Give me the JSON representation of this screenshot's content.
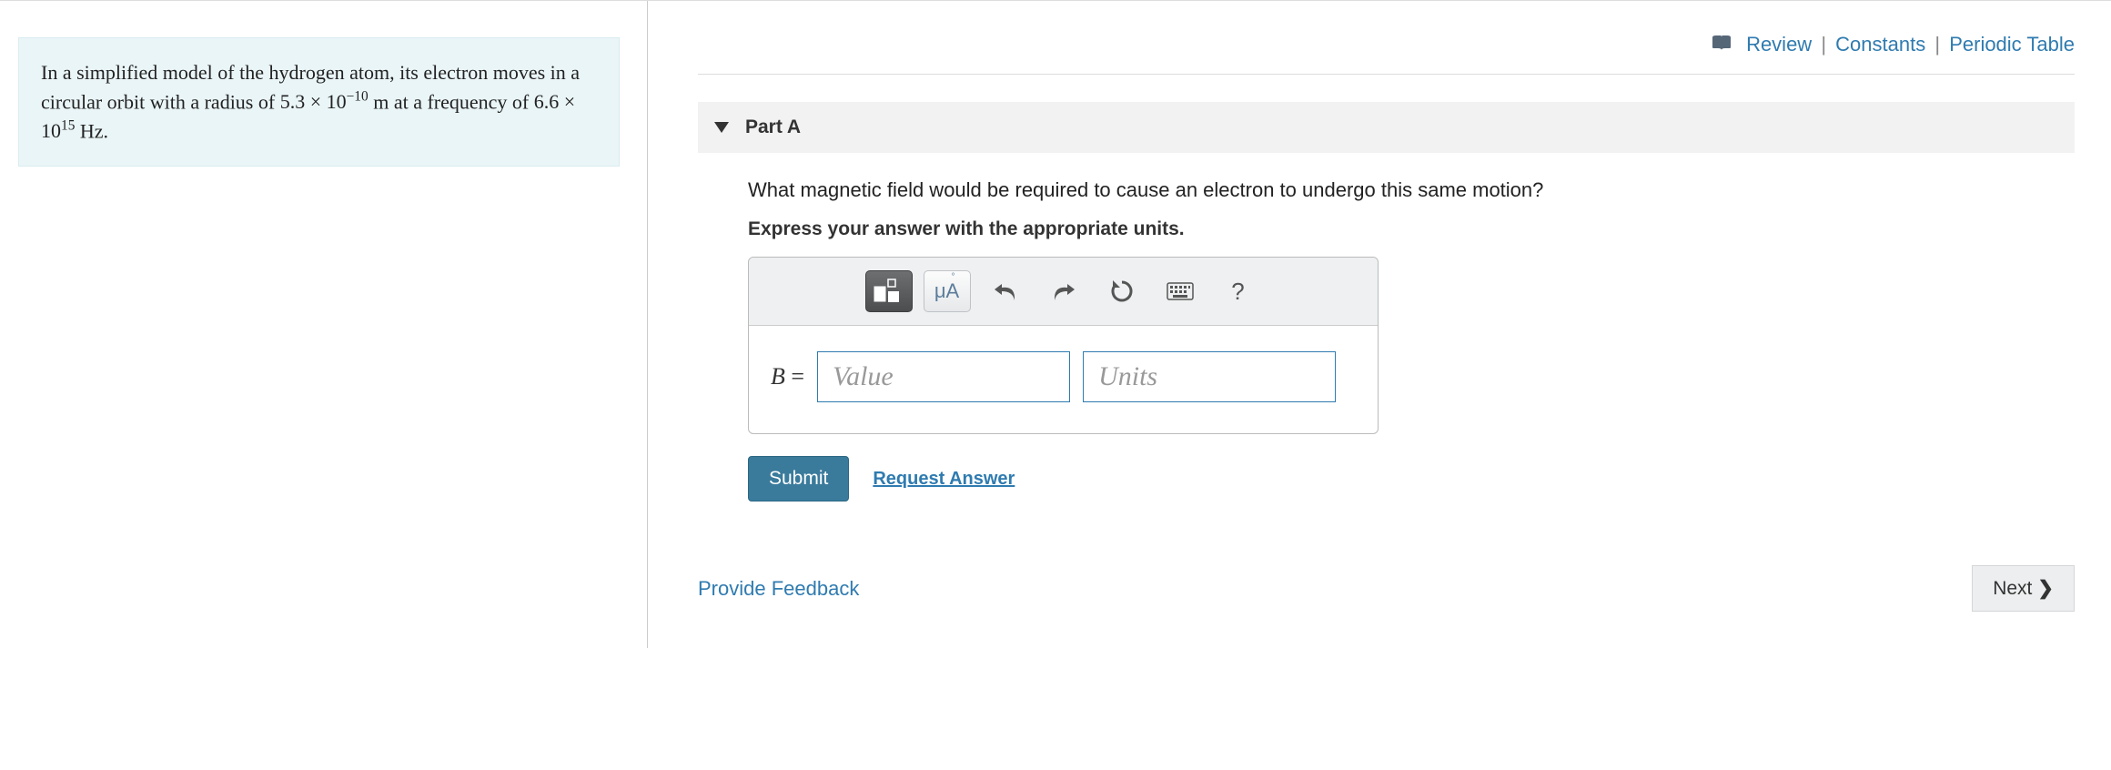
{
  "problem": {
    "intro_a": "In a simplified model of the hydrogen atom, its electron moves in a circular orbit with a radius of ",
    "radius_coef": "5.3",
    "radius_exp": "−10",
    "radius_unit": " m",
    "mid": " at a frequency of ",
    "freq_coef": "6.6",
    "freq_exp": "15",
    "freq_unit": " Hz."
  },
  "top_links": {
    "review": "Review",
    "constants": "Constants",
    "periodic": "Periodic Table"
  },
  "part": {
    "title": "Part A",
    "question": "What magnetic field would be required to cause an electron to undergo this same motion?",
    "instruction": "Express your answer with the appropriate units."
  },
  "toolbar": {
    "template_label": "template",
    "special_label": "μÅ",
    "undo_label": "undo",
    "redo_label": "redo",
    "reset_label": "reset",
    "keyboard_label": "keyboard",
    "help_label": "?"
  },
  "answer": {
    "var_label": "B",
    "equals": " = ",
    "value_placeholder": "Value",
    "units_placeholder": "Units"
  },
  "actions": {
    "submit": "Submit",
    "request": "Request Answer"
  },
  "footer": {
    "feedback": "Provide Feedback",
    "next": "Next"
  }
}
